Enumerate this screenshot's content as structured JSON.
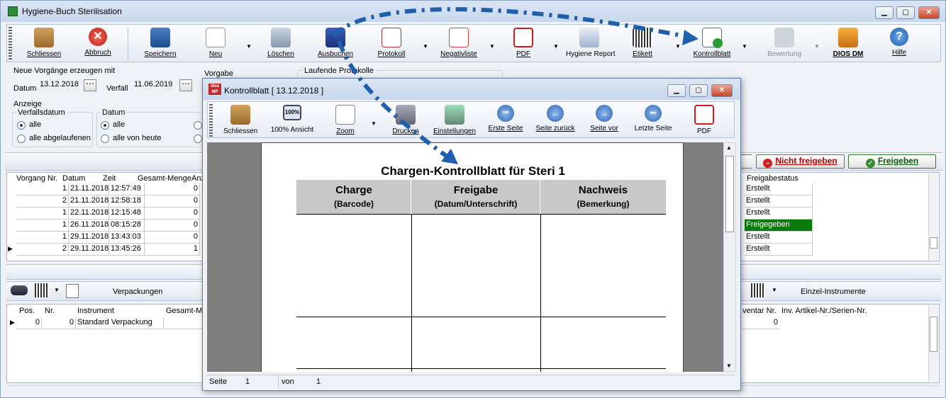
{
  "window": {
    "title": "Hygiene-Buch Sterilisation"
  },
  "toolbar": {
    "items": [
      "Schliessen",
      "Abbruch",
      "Speichern",
      "Neu",
      "Löschen",
      "Ausbuchen",
      "Protokoll",
      "Negativliste",
      "PDF",
      "Hygiene Report",
      "Etikett",
      "Kontrollblatt",
      "Bewertung",
      "DIOS DM",
      "Hilfe"
    ]
  },
  "form": {
    "create_label": "Neue Vorgänge erzeugen mit",
    "datum_label": "Datum",
    "datum_value": "13.12.2018",
    "verfall_label": "Verfall",
    "verfall_value": "11.06.2019",
    "vorgabe_label": "Vorgabe",
    "laufende_label": "Laufende Protokolle",
    "anzeige_label": "Anzeige",
    "verfallsdatum_label": "Verfallsdatum",
    "verfall_opt1": "alle",
    "verfall_opt2": "alle abgelaufenen",
    "datum_group_label": "Datum",
    "datum_opt1": "alle",
    "datum_opt2": "alle von heute"
  },
  "buttons": {
    "nicht_freigeben": "Nicht freigeben",
    "freigeben": "Freigeben"
  },
  "vorgang_table": {
    "headers": [
      "Vorgang Nr.",
      "Datum",
      "Zeit",
      "Gesamt-Menge",
      "Anz"
    ],
    "rows": [
      [
        "1",
        "21.11.2018",
        "12:57:49",
        "0"
      ],
      [
        "2",
        "21.11.2018",
        "12:58:18",
        "0"
      ],
      [
        "1",
        "22.11.2018",
        "12:15:48",
        "0"
      ],
      [
        "1",
        "26.11.2018",
        "08:15:28",
        "0"
      ],
      [
        "1",
        "29.11.2018",
        "13:43:03",
        "0"
      ],
      [
        "2",
        "29.11.2018",
        "13:45:26",
        "1"
      ]
    ],
    "status_header": "Freigabestatus",
    "status": [
      "Erstellt",
      "Erstellt",
      "Erstellt",
      "Freigegeben",
      "Erstellt",
      "Erstellt"
    ]
  },
  "verpackungen": {
    "title": "Verpackungen",
    "headers": [
      "Pos.",
      "Nr.",
      "Instrument",
      "Gesamt-Me"
    ],
    "row": [
      "0",
      "0",
      "Standard Verpackung"
    ]
  },
  "einzel": {
    "title": "Einzel-Instrumente",
    "headers": [
      "ventar Nr.",
      "Inv. Artikel-Nr./Serien-Nr."
    ],
    "row": [
      "0"
    ]
  },
  "dialog": {
    "title": "Kontrollblatt [ 13.12.2018 ]",
    "toolbar": [
      "Schliessen",
      "100% Ansicht",
      "Zoom",
      "Drucken",
      "Einstellungen",
      "Erste Seite",
      "Seite zurück",
      "Seite vor",
      "Letzte Seite",
      "PDF"
    ],
    "zoom_icon_text": "100%",
    "logo": "dios MP",
    "status": {
      "seite_label": "Seite",
      "seite": "1",
      "von_label": "von",
      "von": "1"
    }
  },
  "report": {
    "title": "Chargen-Kontrollblatt für Steri 1",
    "columns": [
      {
        "name": "Charge",
        "sub": "(Barcode)"
      },
      {
        "name": "Freigabe",
        "sub": "(Datum/Unterschrift)"
      },
      {
        "name": "Nachweis",
        "sub": "(Bemerkung)"
      }
    ]
  },
  "colors": {
    "accent": "#1f5fae",
    "freigegeben": "#0a7a0a",
    "red": "#d21f1f",
    "green": "#2f8f2f"
  }
}
